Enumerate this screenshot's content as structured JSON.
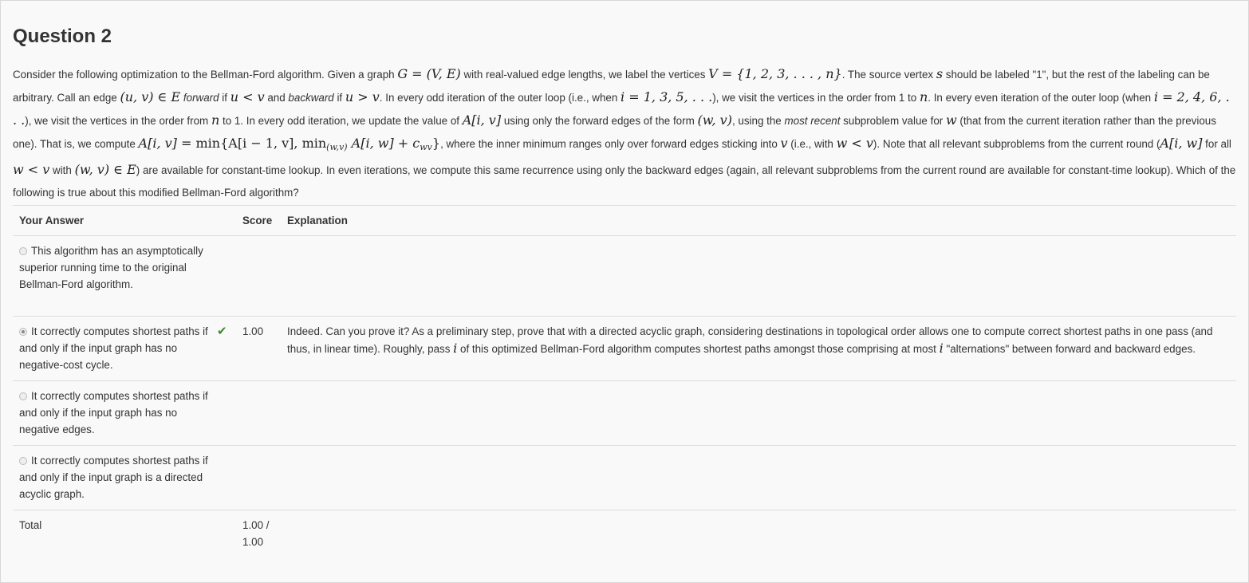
{
  "question": {
    "title": "Question 2"
  },
  "table": {
    "headers": {
      "answer": "Your Answer",
      "score": "Score",
      "explanation": "Explanation"
    },
    "options": [
      {
        "text": "This algorithm has an asymptotically superior running time to the original Bellman-Ford algorithm.",
        "selected": false,
        "score": "",
        "explanation": ""
      },
      {
        "text": "It correctly computes shortest paths if and only if the input graph has no negative-cost cycle.",
        "selected": true,
        "score": "1.00",
        "explanation_parts": [
          "Indeed. Can you prove it? As a preliminary step, prove that with a directed acyclic graph, considering destinations in topological order allows one to compute correct shortest paths in one pass (and thus, in linear time). Roughly, pass ",
          "i",
          " of this optimized Bellman-Ford algorithm computes shortest paths amongst those comprising at most ",
          "i",
          " \"alternations\" between forward and backward edges."
        ]
      },
      {
        "text": "It correctly computes shortest paths if and only if the input graph has no negative edges.",
        "selected": false,
        "score": "",
        "explanation": ""
      },
      {
        "text": "It correctly computes shortest paths if and only if the input graph is a directed acyclic graph.",
        "selected": false,
        "score": "",
        "explanation": ""
      }
    ],
    "total": {
      "label": "Total",
      "score": "1.00 / 1.00"
    }
  },
  "prompt_segments": {
    "s1": "Consider the following optimization to the Bellman-Ford algorithm. Given a graph ",
    "m1": "G = (V, E)",
    "s2": " with real-valued edge lengths, we label the vertices ",
    "m2": "V = {1, 2, 3, . . . , n}",
    "s3": ". The source vertex ",
    "m3": "s",
    "s4": " should be labeled \"1\", but the rest of the labeling can be arbitrary. Call an edge ",
    "m4": "(u, v) ∈ E",
    "s5a": " ",
    "e1": "forward",
    "s5b": " if ",
    "m5": "u < v",
    "s6a": " and ",
    "e2": "backward",
    "s6b": " if ",
    "m6": "u > v",
    "s7": ". In every odd iteration of the outer loop (i.e., when ",
    "m7": "i = 1, 3, 5, . . .",
    "s8": "), we visit the vertices in the order from 1 to ",
    "m8": "n",
    "s9": ". In every even iteration of the outer loop (when ",
    "m9": "i = 2, 4, 6, . . .",
    "s10": "), we visit the vertices in the order from ",
    "m10": "n",
    "s11": " to 1. In every odd iteration, we update the value of ",
    "m11": "A[i, v]",
    "s12": " using only the forward edges of the form ",
    "m12": "(w, v)",
    "s13a": ", using the ",
    "e3": "most recent",
    "s13b": " subproblem value for ",
    "m13": "w",
    "s14": " (that from the current iteration rather than the previous one). That is, we compute ",
    "m14a": "A[i, v] = ",
    "m14b": "min{A[i − 1, v], min",
    "m14c": "(w,v)",
    "m14d": " A[i, w] + c",
    "m14e": "wv",
    "m14f": "}",
    "s15": ", where the inner minimum ranges only over forward edges sticking into ",
    "m15": "v",
    "s16": " (i.e., with ",
    "m16": "w < v",
    "s17": "). Note that all relevant subproblems from the current round (",
    "m17": "A[i, w]",
    "s18": " for all ",
    "m18": "w < v",
    "s19": " with ",
    "m19": "(w, v) ∈ E",
    "s20": ") are available for constant-time lookup. In even iterations, we compute this same recurrence using only the backward edges (again, all relevant subproblems from the current round are available for constant-time lookup). Which of the following is true about this modified Bellman-Ford algorithm?"
  }
}
